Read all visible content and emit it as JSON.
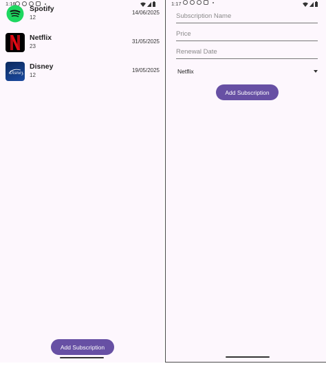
{
  "left_screen": {
    "status": {
      "time": "1:16"
    },
    "subscriptions": [
      {
        "name": "Spotify",
        "count": "12",
        "date": "14/06/2025",
        "icon": "spotify-logo"
      },
      {
        "name": "Netflix",
        "count": "23",
        "date": "31/05/2025",
        "icon": "netflix-logo"
      },
      {
        "name": "Disney",
        "count": "12",
        "date": "19/05/2025",
        "icon": "disney-logo"
      }
    ],
    "add_button_label": "Add Subscription"
  },
  "right_screen": {
    "status": {
      "time": "1:17"
    },
    "form": {
      "name_placeholder": "Subscription Name",
      "price_placeholder": "Price",
      "renewal_placeholder": "Renewal Date",
      "selected_service": "Netflix"
    },
    "add_button_label": "Add Subscription"
  },
  "colors": {
    "primary": "#6750a4",
    "background": "#fdf7fd",
    "spotify": "#1ed760",
    "netflix": "#e50914"
  }
}
